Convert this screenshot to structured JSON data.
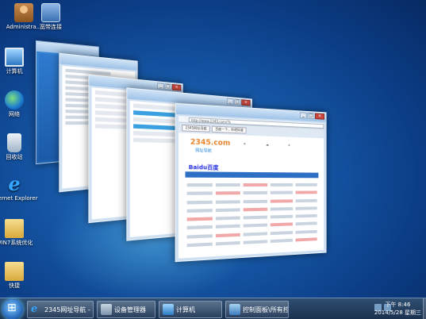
{
  "desktop": {
    "icons": [
      {
        "label": "Administra...",
        "icon": "user-folder-icon"
      },
      {
        "label": "宽带连接",
        "icon": "broadband-icon"
      },
      {
        "label": "计算机",
        "icon": "computer-icon"
      },
      {
        "label": "网络",
        "icon": "network-icon"
      },
      {
        "label": "回收站",
        "icon": "recycle-bin-icon"
      },
      {
        "label": "Internet Explorer",
        "icon": "ie-icon"
      },
      {
        "label": "WIN7系统优化",
        "icon": "folder-icon"
      },
      {
        "label": "快捷",
        "icon": "folder-icon"
      }
    ]
  },
  "browser": {
    "url": "http://www.2345.com/?k",
    "tabs": [
      "2345网址导航",
      "百度一下，你就知道"
    ],
    "logo": "2345.com",
    "logo_sub": "网址导航",
    "search_brand": "Baidu百度"
  },
  "taskbar": {
    "items": [
      {
        "label": "2345网址导航 - ...",
        "icon": "ie-icon"
      },
      {
        "label": "设备管理器",
        "icon": "device-manager-icon"
      },
      {
        "label": "计算机",
        "icon": "computer-icon"
      },
      {
        "label": "控制面板\\所有控...",
        "icon": "control-panel-icon"
      }
    ],
    "time": "下午 8:46",
    "date": "2014/5/28 星期三"
  },
  "colors": {
    "desktop": "#1659a8",
    "taskbar": "#1b3150",
    "accent": "#2d6fc4"
  }
}
